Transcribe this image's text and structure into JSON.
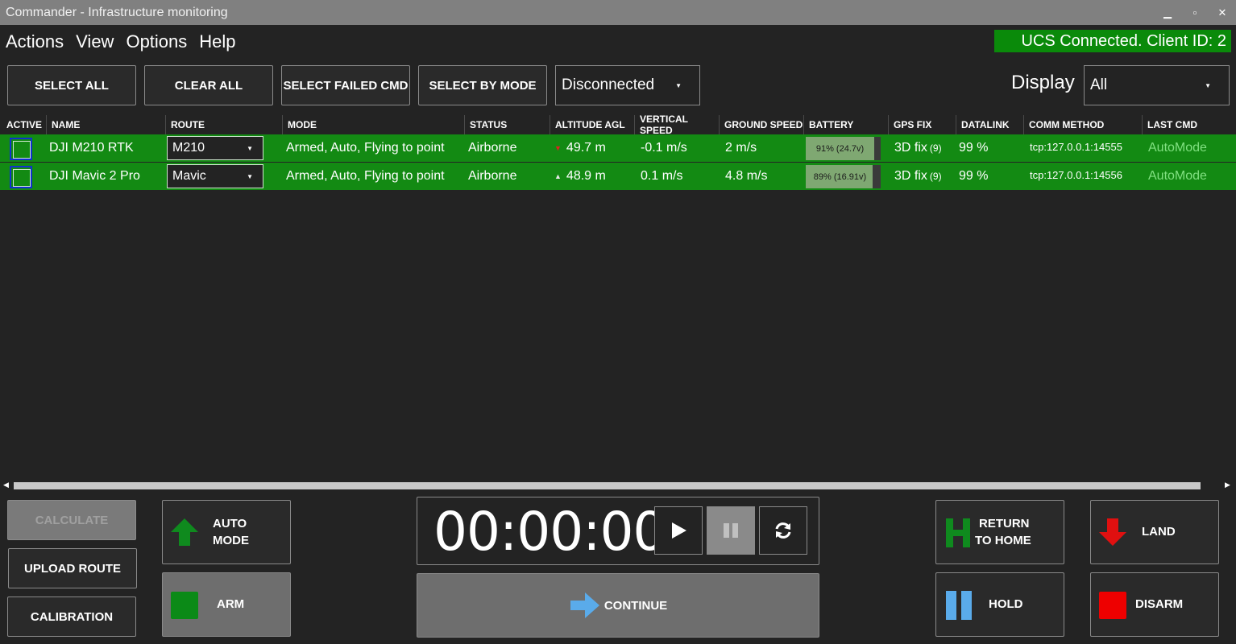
{
  "window": {
    "title": "Commander - Infrastructure monitoring"
  },
  "menu": [
    "Actions",
    "View",
    "Options",
    "Help"
  ],
  "ucs_status": "UCS Connected. Client ID: 2",
  "toolbar": {
    "select_all": "SELECT ALL",
    "clear_all": "CLEAR ALL",
    "select_failed": "SELECT FAILED CMD",
    "select_by_mode": "SELECT BY MODE",
    "mode_filter": "Disconnected",
    "display_label": "Display",
    "display_value": "All"
  },
  "columns": [
    "ACTIVE",
    "NAME",
    "ROUTE",
    "MODE",
    "STATUS",
    "ALTITUDE AGL",
    "VERTICAL SPEED",
    "GROUND SPEED",
    "BATTERY",
    "GPS FIX",
    "DATALINK",
    "COMM METHOD",
    "LAST CMD"
  ],
  "vehicles": [
    {
      "name": "DJI M210 RTK",
      "route": "M210",
      "mode": "Armed, Auto, Flying to point",
      "status": "Airborne",
      "altitude": "49.7 m",
      "vspeed": "-0.1 m/s",
      "gspeed": "2 m/s",
      "battery": "91% (24.7v)",
      "battery_level": 0.91,
      "gps": "3D fix",
      "gps_sats": "(9)",
      "datalink": "99 %",
      "comm": "tcp:127.0.0.1:14555",
      "last_cmd": "AutoMode"
    },
    {
      "name": "DJI Mavic 2 Pro",
      "route": "Mavic",
      "mode": "Armed, Auto, Flying to point",
      "status": "Airborne",
      "altitude": "48.9 m",
      "vspeed": "0.1 m/s",
      "gspeed": "4.8 m/s",
      "battery": "89% (16.91v)",
      "battery_level": 0.89,
      "gps": "3D fix",
      "gps_sats": "(9)",
      "datalink": "99 %",
      "comm": "tcp:127.0.0.1:14556",
      "last_cmd": "AutoMode"
    }
  ],
  "controls": {
    "calculate": "CALCULATE",
    "upload_route": "UPLOAD ROUTE",
    "calibration": "CALIBRATION",
    "auto_mode_1": "AUTO",
    "auto_mode_2": "MODE",
    "arm": "ARM",
    "timer": "00:00:00",
    "continue": "CONTINUE",
    "rth_1": "RETURN",
    "rth_2": "TO HOME",
    "hold": "HOLD",
    "land": "LAND",
    "disarm": "DISARM"
  }
}
